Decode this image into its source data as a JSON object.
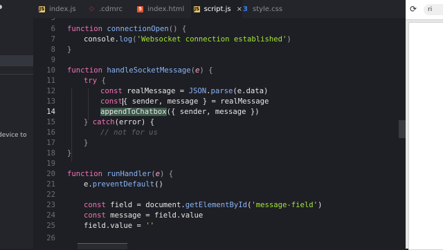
{
  "sidebar": {
    "hint_text": "device to"
  },
  "tabs": [
    {
      "label": "index.js",
      "icon": "js-file-icon",
      "active": false,
      "icon_text": "JS"
    },
    {
      "label": ".cdmrc",
      "icon": "config-file-icon",
      "active": false,
      "icon_text": "◇"
    },
    {
      "label": "index.html",
      "icon": "html-file-icon",
      "active": false,
      "icon_text": "5"
    },
    {
      "label": "script.js",
      "icon": "js-file-icon",
      "active": true,
      "icon_text": "JS",
      "close": "×"
    },
    {
      "label": "style.css",
      "icon": "css-file-icon",
      "active": false,
      "icon_text": "3"
    }
  ],
  "editor": {
    "current_line": 14,
    "lines": [
      {
        "n": "5"
      },
      {
        "n": "6"
      },
      {
        "n": "7"
      },
      {
        "n": "8"
      },
      {
        "n": "9"
      },
      {
        "n": "10"
      },
      {
        "n": "11"
      },
      {
        "n": "12"
      },
      {
        "n": "13"
      },
      {
        "n": "14"
      },
      {
        "n": "15"
      },
      {
        "n": "16"
      },
      {
        "n": "17"
      },
      {
        "n": "18"
      },
      {
        "n": "19"
      },
      {
        "n": "20"
      },
      {
        "n": "21"
      },
      {
        "n": "22"
      },
      {
        "n": "23"
      },
      {
        "n": "24"
      },
      {
        "n": "25"
      },
      {
        "n": "26"
      }
    ],
    "tokens": {
      "l6_kw": "function",
      "l6_fn": "connectionOpen",
      "l6_rest": "() {",
      "l7_a": "console.",
      "l7_fn": "log",
      "l7_p": "(",
      "l7_str": "'Websocket connection established'",
      "l7_q": ")",
      "l8": "}",
      "l10_kw": "function",
      "l10_fn": "handleSocketMessage",
      "l10_p": "(",
      "l10_param": "e",
      "l10_q": ") {",
      "l11_kw": "try",
      "l11_rest": " {",
      "l12_kw": "const",
      "l12_a": " realMessage = ",
      "l12_cls": "JSON",
      "l12_b": ".",
      "l12_fn": "parse",
      "l12_c": "(e.data)",
      "l13_kw": "const",
      "l13_a": "{ sender, message } = realMessage",
      "l14_hl": "appendToChatbox",
      "l14_rest": "({ sender, message })",
      "l15_a": "} ",
      "l15_kw": "catch",
      "l15_b": "(error) {",
      "l16_cm": "// not for us",
      "l17": "}",
      "l18": "}",
      "l20_kw": "function",
      "l20_fn": "runHandler",
      "l20_p": "(",
      "l20_param": "e",
      "l20_q": ") {",
      "l21_a": "e.",
      "l21_fn": "preventDefault",
      "l21_b": "()",
      "l23_kw": "const",
      "l23_a": " field = document.",
      "l23_fn": "getElementById",
      "l23_p": "(",
      "l23_str": "'message-field'",
      "l23_q": ")",
      "l24_kw": "const",
      "l24_a": " message = field.value",
      "l25_a": "field.value = ",
      "l25_str": "''"
    }
  },
  "browser": {
    "reload_icon": "⟳",
    "url_text": "ri"
  }
}
